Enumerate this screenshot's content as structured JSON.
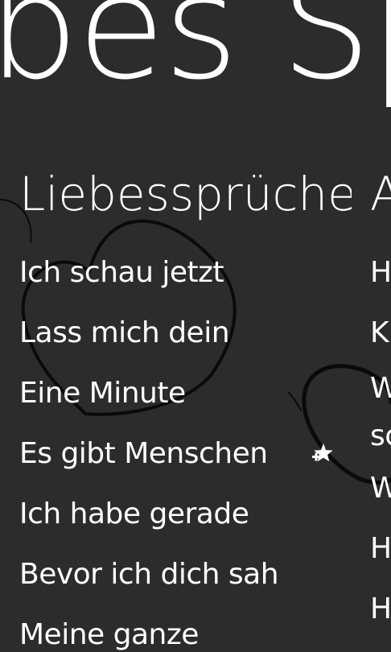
{
  "app": {
    "panorama_title": "bes Sp"
  },
  "sections": {
    "main": {
      "header": "Liebessprüche",
      "items": [
        "Ich schau jetzt",
        "Lass mich dein",
        "Eine Minute",
        "Es gibt Menschen",
        "Ich habe gerade",
        "Bevor ich dich sah",
        "Meine ganze"
      ]
    },
    "next": {
      "header": "A",
      "items": [
        "H",
        "K",
        "W",
        "sc",
        "W",
        "H",
        "H"
      ]
    }
  },
  "icons": {
    "favorite": "star-plus-icon",
    "background": "heart-outline-decorations"
  },
  "colors": {
    "background": "#2c2c2c",
    "text": "#ffffff",
    "decoration": "#0a0a0a"
  }
}
